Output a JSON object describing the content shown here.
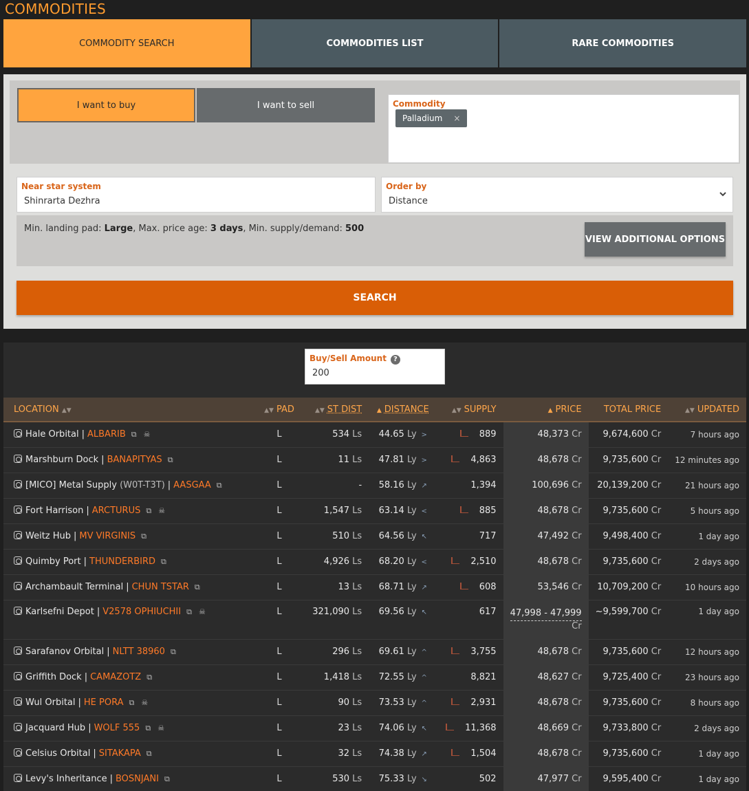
{
  "page_title": "COMMODITIES",
  "tabs": [
    {
      "label": "COMMODITY SEARCH",
      "active": true
    },
    {
      "label": "COMMODITIES LIST",
      "active": false
    },
    {
      "label": "RARE COMMODITIES",
      "active": false
    }
  ],
  "search": {
    "buy_label": "I want to buy",
    "sell_label": "I want to sell",
    "commodity_label": "Commodity",
    "commodity_value": "Palladium",
    "commodity_remove": "×",
    "star_label": "Near star system",
    "star_value": "Shinrarta Dezhra",
    "order_label": "Order by",
    "order_value": "Distance",
    "options_prefix_pad": "Min. landing pad: ",
    "options_pad": "Large",
    "options_prefix_age": ", Max. price age: ",
    "options_age": "3 days",
    "options_prefix_supply": ", Min. supply/demand: ",
    "options_supply": "500",
    "more_options": "VIEW ADDITIONAL OPTIONS",
    "search_button": "SEARCH"
  },
  "amount": {
    "label": "Buy/Sell Amount",
    "help": "?",
    "value": "200"
  },
  "table": {
    "headers": {
      "location": "LOCATION",
      "pad": "PAD",
      "st_dist": "ST DIST",
      "distance": "DISTANCE",
      "supply": "SUPPLY",
      "price": "PRICE",
      "total": "TOTAL PRICE",
      "updated": "UPDATED"
    },
    "rows": [
      {
        "station": "Hale Orbital",
        "system": "ALBARIB",
        "skull": true,
        "pad": "L",
        "st_dist": "534",
        "st_unit": "Ls",
        "dist": "44.65",
        "arrow": ">",
        "bars": true,
        "supply": "889",
        "price": "48,373",
        "total": "9,674,600",
        "updated": "7 hours ago"
      },
      {
        "station": "Marshburn Dock",
        "system": "BANAPITYAS",
        "skull": false,
        "pad": "L",
        "st_dist": "11",
        "st_unit": "Ls",
        "dist": "47.81",
        "arrow": ">",
        "bars": true,
        "supply": "4,863",
        "price": "48,678",
        "total": "9,735,600",
        "updated": "12 minutes ago"
      },
      {
        "station": "[MICO] Metal Supply",
        "sub": "(W0T-T3T)",
        "system": "AASGAA",
        "skull": false,
        "pad": "L",
        "st_dist": "-",
        "st_unit": "",
        "dist": "58.16",
        "arrow": "↗",
        "bars": false,
        "supply": "1,394",
        "price": "100,696",
        "total": "20,139,200",
        "updated": "21 hours ago"
      },
      {
        "station": "Fort Harrison",
        "system": "ARCTURUS",
        "skull": true,
        "pad": "L",
        "st_dist": "1,547",
        "st_unit": "Ls",
        "dist": "63.14",
        "arrow": "<",
        "bars": true,
        "supply": "885",
        "price": "48,678",
        "total": "9,735,600",
        "updated": "5 hours ago"
      },
      {
        "station": "Weitz Hub",
        "system": "MV VIRGINIS",
        "skull": false,
        "pad": "L",
        "st_dist": "510",
        "st_unit": "Ls",
        "dist": "64.56",
        "arrow": "↖",
        "bars": false,
        "supply": "717",
        "price": "47,492",
        "total": "9,498,400",
        "updated": "1 day ago"
      },
      {
        "station": "Quimby Port",
        "system": "THUNDERBIRD",
        "skull": false,
        "pad": "L",
        "st_dist": "4,926",
        "st_unit": "Ls",
        "dist": "68.20",
        "arrow": "<",
        "bars": true,
        "supply": "2,510",
        "price": "48,678",
        "total": "9,735,600",
        "updated": "2 days ago"
      },
      {
        "station": "Archambault Terminal",
        "system": "CHUN TSTAR",
        "skull": false,
        "pad": "L",
        "st_dist": "13",
        "st_unit": "Ls",
        "dist": "68.71",
        "arrow": "↗",
        "bars": true,
        "supply": "608",
        "price": "53,546",
        "total": "10,709,200",
        "updated": "10 hours ago"
      },
      {
        "station": "Karlsefni Depot",
        "system": "V2578 OPHIUCHII",
        "skull": true,
        "pad": "L",
        "st_dist": "321,090",
        "st_unit": "Ls",
        "dist": "69.56",
        "arrow": "↖",
        "bars": false,
        "supply": "617",
        "price": "47,998 - 47,999",
        "total": "~9,599,700",
        "updated": "1 day ago",
        "tall": true
      },
      {
        "station": "Sarafanov Orbital",
        "system": "NLTT 38960",
        "skull": false,
        "pad": "L",
        "st_dist": "296",
        "st_unit": "Ls",
        "dist": "69.61",
        "arrow": "^",
        "bars": true,
        "supply": "3,755",
        "price": "48,678",
        "total": "9,735,600",
        "updated": "12 hours ago"
      },
      {
        "station": "Griffith Dock",
        "system": "CAMAZOTZ",
        "skull": false,
        "pad": "L",
        "st_dist": "1,418",
        "st_unit": "Ls",
        "dist": "72.55",
        "arrow": "^",
        "bars": false,
        "supply": "8,821",
        "price": "48,627",
        "total": "9,725,400",
        "updated": "23 hours ago"
      },
      {
        "station": "Wul Orbital",
        "system": "HE PORA",
        "skull": true,
        "pad": "L",
        "st_dist": "90",
        "st_unit": "Ls",
        "dist": "73.53",
        "arrow": "^",
        "bars": true,
        "supply": "2,931",
        "price": "48,678",
        "total": "9,735,600",
        "updated": "8 hours ago"
      },
      {
        "station": "Jacquard Hub",
        "system": "WOLF 555",
        "skull": true,
        "pad": "L",
        "st_dist": "23",
        "st_unit": "Ls",
        "dist": "74.06",
        "arrow": "↖",
        "bars": true,
        "supply": "11,368",
        "price": "48,669",
        "total": "9,733,800",
        "updated": "2 days ago"
      },
      {
        "station": "Celsius Orbital",
        "system": "SITAKAPA",
        "skull": false,
        "pad": "L",
        "st_dist": "32",
        "st_unit": "Ls",
        "dist": "74.38",
        "arrow": "↗",
        "bars": true,
        "supply": "1,504",
        "price": "48,678",
        "total": "9,735,600",
        "updated": "1 day ago"
      },
      {
        "station": "Levy's Inheritance",
        "system": "BOSNJANI",
        "skull": false,
        "pad": "L",
        "st_dist": "530",
        "st_unit": "Ls",
        "dist": "75.33",
        "arrow": "↘",
        "bars": false,
        "supply": "502",
        "price": "47,977",
        "total": "9,595,400",
        "updated": "1 day ago"
      }
    ]
  },
  "units": {
    "ly": "Ly",
    "cr": "Cr"
  },
  "icons": {
    "station": "station-icon",
    "external": "external-link-icon",
    "skull": "skull-icon",
    "chevron": "chevron-down-icon",
    "supply_chart": "supply-chart-icon"
  },
  "colors": {
    "accent": "#ffa43e",
    "system_link": "#ff7a28",
    "search_button": "#d95e06",
    "tab_inactive": "#4b5a61"
  }
}
